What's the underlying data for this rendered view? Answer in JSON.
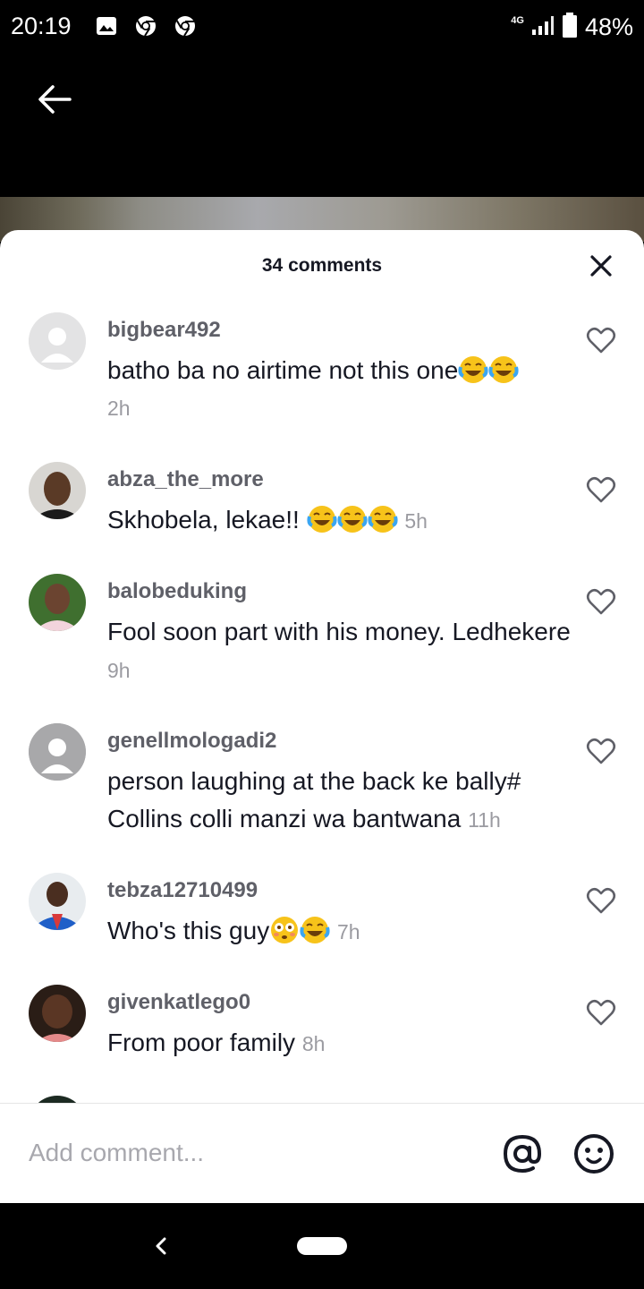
{
  "status_bar": {
    "time": "20:19",
    "network": "4G",
    "battery": "48%",
    "icons": [
      "image-icon",
      "chrome-icon",
      "chrome-icon",
      "signal-icon",
      "battery-icon"
    ]
  },
  "sheet": {
    "title": "34 comments"
  },
  "comments": [
    {
      "user": "bigbear492",
      "text": "batho ba no airtime not this one",
      "emojis": [
        "joy",
        "joy"
      ],
      "time": "2h",
      "avatar": "default"
    },
    {
      "user": "abza_the_more",
      "text": "Skhobela, lekae!! ",
      "emojis": [
        "joy",
        "joy",
        "joy"
      ],
      "time": "5h",
      "avatar": "photo"
    },
    {
      "user": "balobeduking",
      "text": "Fool soon part with his money. Ledhekere",
      "emojis": [],
      "time": "9h",
      "avatar": "photo"
    },
    {
      "user": "genellmologadi2",
      "text": "person laughing at the back ke bally# Collins colli manzi wa bantwana",
      "emojis": [],
      "time": "11h",
      "avatar": "default"
    },
    {
      "user": "tebza12710499",
      "text": "Who's this guy",
      "emojis": [
        "flushed",
        "joy"
      ],
      "time": "7h",
      "avatar": "photo"
    },
    {
      "user": "givenkatlego0",
      "text": "From poor family",
      "emojis": [],
      "time": "8h",
      "avatar": "photo"
    }
  ],
  "input": {
    "placeholder": "Add comment..."
  },
  "colors": {
    "text_primary": "#161823",
    "username": "#5f6068",
    "timestamp": "#9b9ba1"
  }
}
